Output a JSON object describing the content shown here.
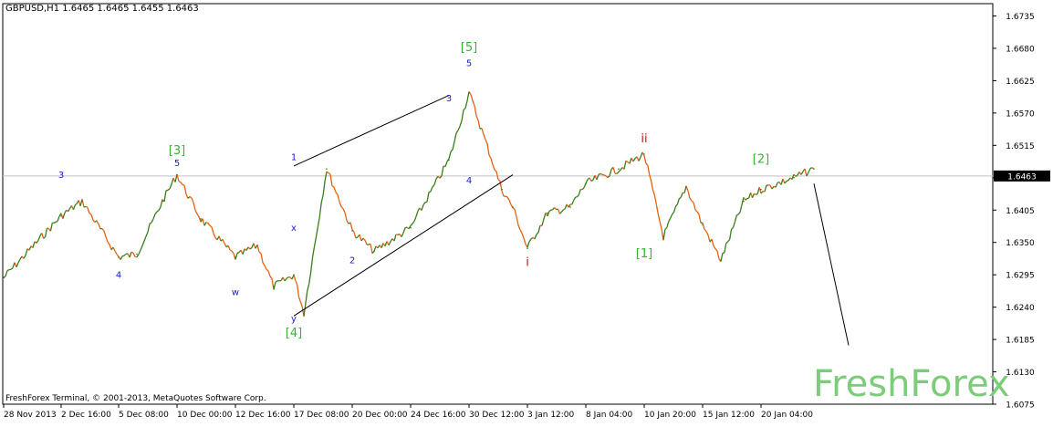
{
  "header": {
    "symbol": "GBPUSD,H1",
    "ohlc": "1.6465 1.6465 1.6455 1.6463"
  },
  "footer": {
    "copyright": "FreshForex Terminal, © 2001-2013, MetaQuotes Software Corp."
  },
  "watermark": "FreshForex",
  "colors": {
    "background": "#ffffff",
    "up_candle": "#3a7d1a",
    "down_candle": "#e8600f",
    "axis": "#000000",
    "price_line": "#c0c0c0",
    "wave_green": "#33b533",
    "wave_blue": "#1a1acc",
    "wave_red": "#cc1111",
    "watermark": "#7ccc7a"
  },
  "chart_data": {
    "type": "line",
    "instrument": "GBPUSD",
    "timeframe": "H1",
    "ylim": [
      1.6075,
      1.6735
    ],
    "y_ticks": [
      "1.6735",
      "1.6680",
      "1.6625",
      "1.6570",
      "1.6515",
      "1.6460",
      "1.6405",
      "1.6350",
      "1.6295",
      "1.6240",
      "1.6185",
      "1.6130",
      "1.6075"
    ],
    "x_ticks": [
      "28 Nov 2013",
      "2 Dec 16:00",
      "5 Dec 08:00",
      "10 Dec 00:00",
      "12 Dec 16:00",
      "17 Dec 08:00",
      "20 Dec 00:00",
      "24 Dec 16:00",
      "30 Dec 12:00",
      "3 Jan 12:00",
      "8 Jan 04:00",
      "10 Jan 20:00",
      "15 Jan 12:00",
      "20 Jan 04:00"
    ],
    "current_price": "1.6463",
    "grid": false,
    "series": [
      {
        "x": [
          "28 Nov 2013",
          "29 Nov 2013",
          "2 Dec 16:00",
          "3 Dec 2013",
          "5 Dec 08:00",
          "6 Dec 2013",
          "9 Dec 2013",
          "10 Dec 00:00",
          "11 Dec 2013",
          "12 Dec 16:00",
          "13 Dec 2013",
          "16 Dec 2013",
          "17 Dec 08:00",
          "18 Dec 2013",
          "19 Dec 2013",
          "20 Dec 00:00",
          "23 Dec 2013",
          "24 Dec 16:00",
          "27 Dec 2013",
          "30 Dec 12:00",
          "31 Dec 2013",
          "2 Jan 2014",
          "3 Jan 12:00",
          "6 Jan 2014",
          "7 Jan 2014",
          "8 Jan 04:00",
          "9 Jan 2014",
          "10 Jan 20:00",
          "13 Jan 2014",
          "14 Jan 2014",
          "15 Jan 12:00",
          "16 Jan 2014",
          "17 Jan 2014",
          "20 Jan 04:00",
          "21 Jan 2014",
          "22 Jan 2014"
        ],
        "y": [
          1.629,
          1.635,
          1.6395,
          1.642,
          1.6325,
          1.633,
          1.642,
          1.6465,
          1.639,
          1.6325,
          1.6345,
          1.6275,
          1.6295,
          1.623,
          1.6475,
          1.637,
          1.6335,
          1.6375,
          1.649,
          1.6605,
          1.644,
          1.641,
          1.634,
          1.64,
          1.641,
          1.645,
          1.6475,
          1.65,
          1.636,
          1.6445,
          1.638,
          1.632,
          1.642,
          1.644,
          1.646,
          1.6475
        ]
      }
    ],
    "annotations": [
      {
        "text": "3",
        "x": "2 Dec 16:00",
        "y": 1.646,
        "color": "#1a1acc"
      },
      {
        "text": "4",
        "x": "5 Dec 08:00",
        "y": 1.629,
        "color": "#1a1acc"
      },
      {
        "text": "[3]",
        "x": "10 Dec 00:00",
        "y": 1.65,
        "color": "#33b533"
      },
      {
        "text": "5",
        "x": "10 Dec 00:00",
        "y": 1.648,
        "color": "#1a1acc"
      },
      {
        "text": "w",
        "x": "12 Dec 16:00",
        "y": 1.626,
        "color": "#1a1acc"
      },
      {
        "text": "x",
        "x": "17 Dec 08:00",
        "y": 1.637,
        "color": "#1a1acc"
      },
      {
        "text": "1",
        "x": "17 Dec 08:00",
        "y": 1.649,
        "color": "#1a1acc"
      },
      {
        "text": "y",
        "x": "17 Dec 08:00",
        "y": 1.6215,
        "color": "#1a1acc"
      },
      {
        "text": "[4]",
        "x": "17 Dec 08:00",
        "y": 1.619,
        "color": "#33b533"
      },
      {
        "text": "2",
        "x": "20 Dec 00:00",
        "y": 1.6315,
        "color": "#1a1acc"
      },
      {
        "text": "3",
        "x": "27 Dec 2013",
        "y": 1.659,
        "color": "#1a1acc"
      },
      {
        "text": "[5]",
        "x": "30 Dec 12:00",
        "y": 1.6675,
        "color": "#33b533"
      },
      {
        "text": "5",
        "x": "30 Dec 12:00",
        "y": 1.665,
        "color": "#1a1acc"
      },
      {
        "text": "4",
        "x": "30 Dec 12:00",
        "y": 1.645,
        "color": "#1a1acc"
      },
      {
        "text": "i",
        "x": "3 Jan 12:00",
        "y": 1.631,
        "color": "#cc1111"
      },
      {
        "text": "ii",
        "x": "10 Jan 20:00",
        "y": 1.652,
        "color": "#cc1111"
      },
      {
        "text": "[1]",
        "x": "10 Jan 20:00",
        "y": 1.6325,
        "color": "#33b533"
      },
      {
        "text": "[2]",
        "x": "20 Jan 04:00",
        "y": 1.6485,
        "color": "#33b533"
      }
    ],
    "trend_lines": [
      {
        "from": {
          "x": "17 Dec 08:00",
          "y": 1.648
        },
        "to": {
          "x": "27 Dec 2013",
          "y": 1.66
        }
      },
      {
        "from": {
          "x": "17 Dec 08:00",
          "y": 1.6225
        },
        "to": {
          "x": "2 Jan 2014",
          "y": 1.6465
        }
      },
      {
        "from": {
          "x": "22 Jan 2014",
          "y": 1.645
        },
        "to": {
          "x": "23 Jan 2014",
          "y": 1.6175
        }
      }
    ]
  }
}
